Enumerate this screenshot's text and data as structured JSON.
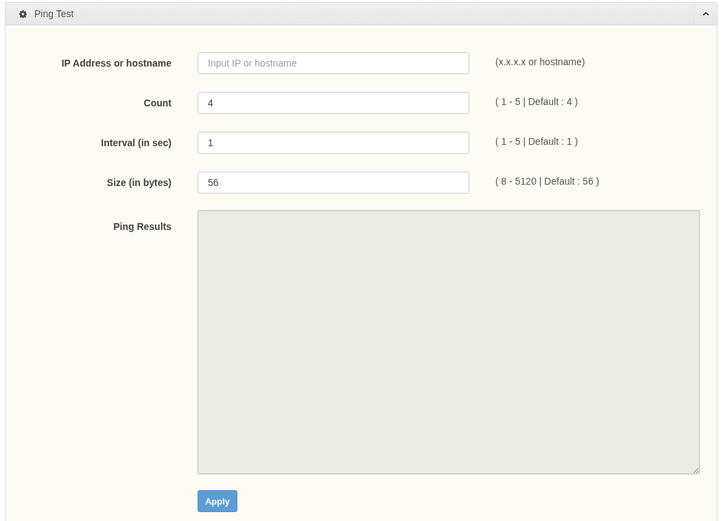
{
  "panel": {
    "title": "Ping Test",
    "expanded": true
  },
  "fields": [
    {
      "label": "IP Address or hostname",
      "placeholder": "Input IP or hostname",
      "hint": "(x.x.x.x or hostname)"
    },
    {
      "label": "Count",
      "value": "4",
      "hint": "( 1 - 5 | Default : 4 )"
    },
    {
      "label": "Interval (in sec)",
      "value": "1",
      "hint": "( 1 - 5 | Default : 1 )"
    },
    {
      "label": "Size (in bytes)",
      "value": "56",
      "hint": "( 8 - 5120 | Default : 56 )"
    }
  ],
  "results": {
    "label": "Ping Results",
    "readonly": true
  },
  "buttons": [
    {
      "label": "Apply"
    }
  ]
}
